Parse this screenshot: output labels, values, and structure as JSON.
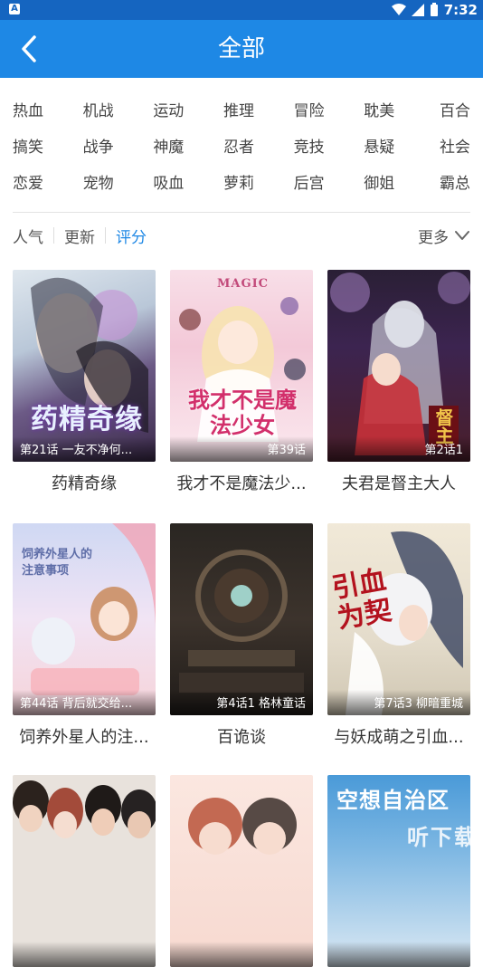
{
  "status_bar": {
    "time": "7:32",
    "notification_icon": "A"
  },
  "app_bar": {
    "title": "全部"
  },
  "genres": [
    [
      "热血",
      "机战",
      "运动",
      "推理",
      "冒险",
      "耽美",
      "百合"
    ],
    [
      "搞笑",
      "战争",
      "神魔",
      "忍者",
      "竞技",
      "悬疑",
      "社会"
    ],
    [
      "恋爱",
      "宠物",
      "吸血",
      "萝莉",
      "后宫",
      "御姐",
      "霸总"
    ]
  ],
  "sort": {
    "options": [
      "人气",
      "更新",
      "评分"
    ],
    "active": "评分",
    "more_label": "更多"
  },
  "comics": [
    {
      "title": "药精奇缘",
      "episode": "第21话 一友不净何...",
      "cover_text": "药精奇缘"
    },
    {
      "title": "我才不是魔法少...",
      "episode": "第39话",
      "cover_text": "我才不是魔法少女",
      "cover_badge": "MAGIC"
    },
    {
      "title": "夫君是督主大人",
      "episode": "第2话1",
      "cover_text": "督主"
    },
    {
      "title": "饲养外星人的注...",
      "episode": "第44话 背后就交给...",
      "cover_text": "饲养外星人的注意事项"
    },
    {
      "title": "百诡谈",
      "episode": "第4话1 格林童话"
    },
    {
      "title": "与妖成萌之引血...",
      "episode": "第7话3 柳暗重城",
      "cover_text": "引血为契"
    },
    {
      "title": "",
      "episode": ""
    },
    {
      "title": "",
      "episode": ""
    },
    {
      "title": "",
      "episode": "",
      "cover_text": "空想自治区"
    }
  ],
  "watermark": "听下载",
  "colors": {
    "status_bar": "#1565c0",
    "app_bar": "#1e88e5",
    "accent": "#1e88e5"
  }
}
